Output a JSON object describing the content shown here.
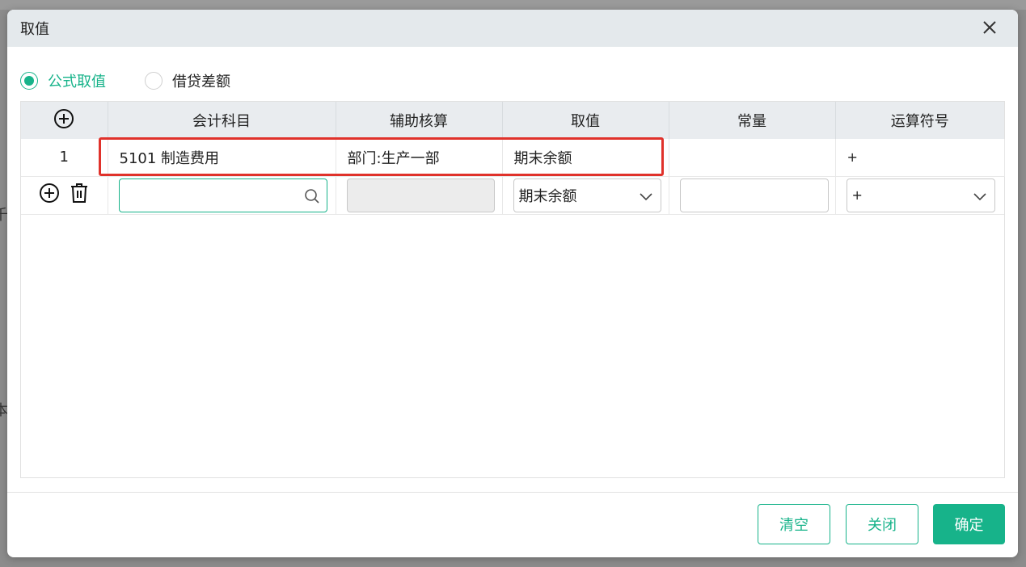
{
  "background": {
    "frag_text_1": "千",
    "frag_text_2": "本"
  },
  "dialog": {
    "title": "取值",
    "close_icon": "close-icon"
  },
  "mode": {
    "options": [
      {
        "label": "公式取值",
        "checked": true
      },
      {
        "label": "借贷差额",
        "checked": false
      }
    ]
  },
  "table": {
    "columns": [
      "会计科目",
      "辅助核算",
      "取值",
      "常量",
      "运算符号"
    ],
    "add_icon": "plus-circle-icon",
    "rows": [
      {
        "index": "1",
        "account": "5101 制造费用",
        "auxiliary": "部门:生产一部",
        "value": "期末余额",
        "constant": "",
        "operator": "+"
      }
    ],
    "edit_row": {
      "account_value": "",
      "auxiliary_value": "",
      "value_selected": "期末余额",
      "constant_value": "",
      "operator_selected": "+"
    }
  },
  "footer": {
    "clear_label": "清空",
    "close_label": "关闭",
    "confirm_label": "确定"
  },
  "colors": {
    "accent": "#17b38a",
    "highlight": "#e0322b",
    "header_bg": "#e4e9ec"
  }
}
